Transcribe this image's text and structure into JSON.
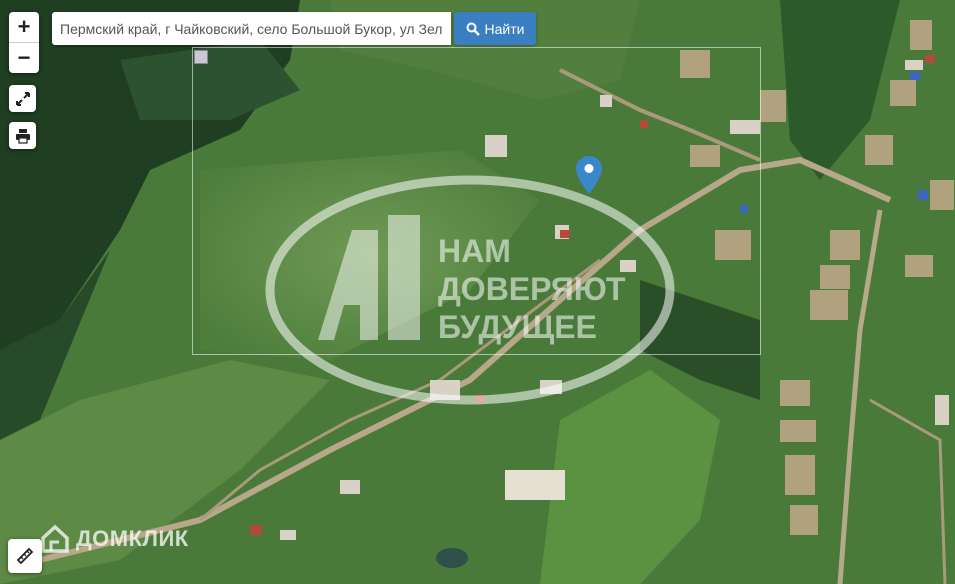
{
  "search": {
    "value": "Пермский край, г Чайковский, село Большой Букор, ул Зеленая",
    "button_label": "Найти",
    "button_icon": "search-icon"
  },
  "controls": {
    "zoom_in": "+",
    "zoom_out": "−",
    "fullscreen_icon": "expand-icon",
    "print_icon": "printer-icon",
    "ruler_icon": "ruler-icon"
  },
  "watermark": {
    "lines": [
      "НАМ",
      "ДОВЕРЯЮТ",
      "БУДУЩЕЕ"
    ]
  },
  "brand": {
    "name": "ДОМКЛИК"
  },
  "colors": {
    "accent": "#3a7fc1",
    "marker": "#3a87cc"
  }
}
